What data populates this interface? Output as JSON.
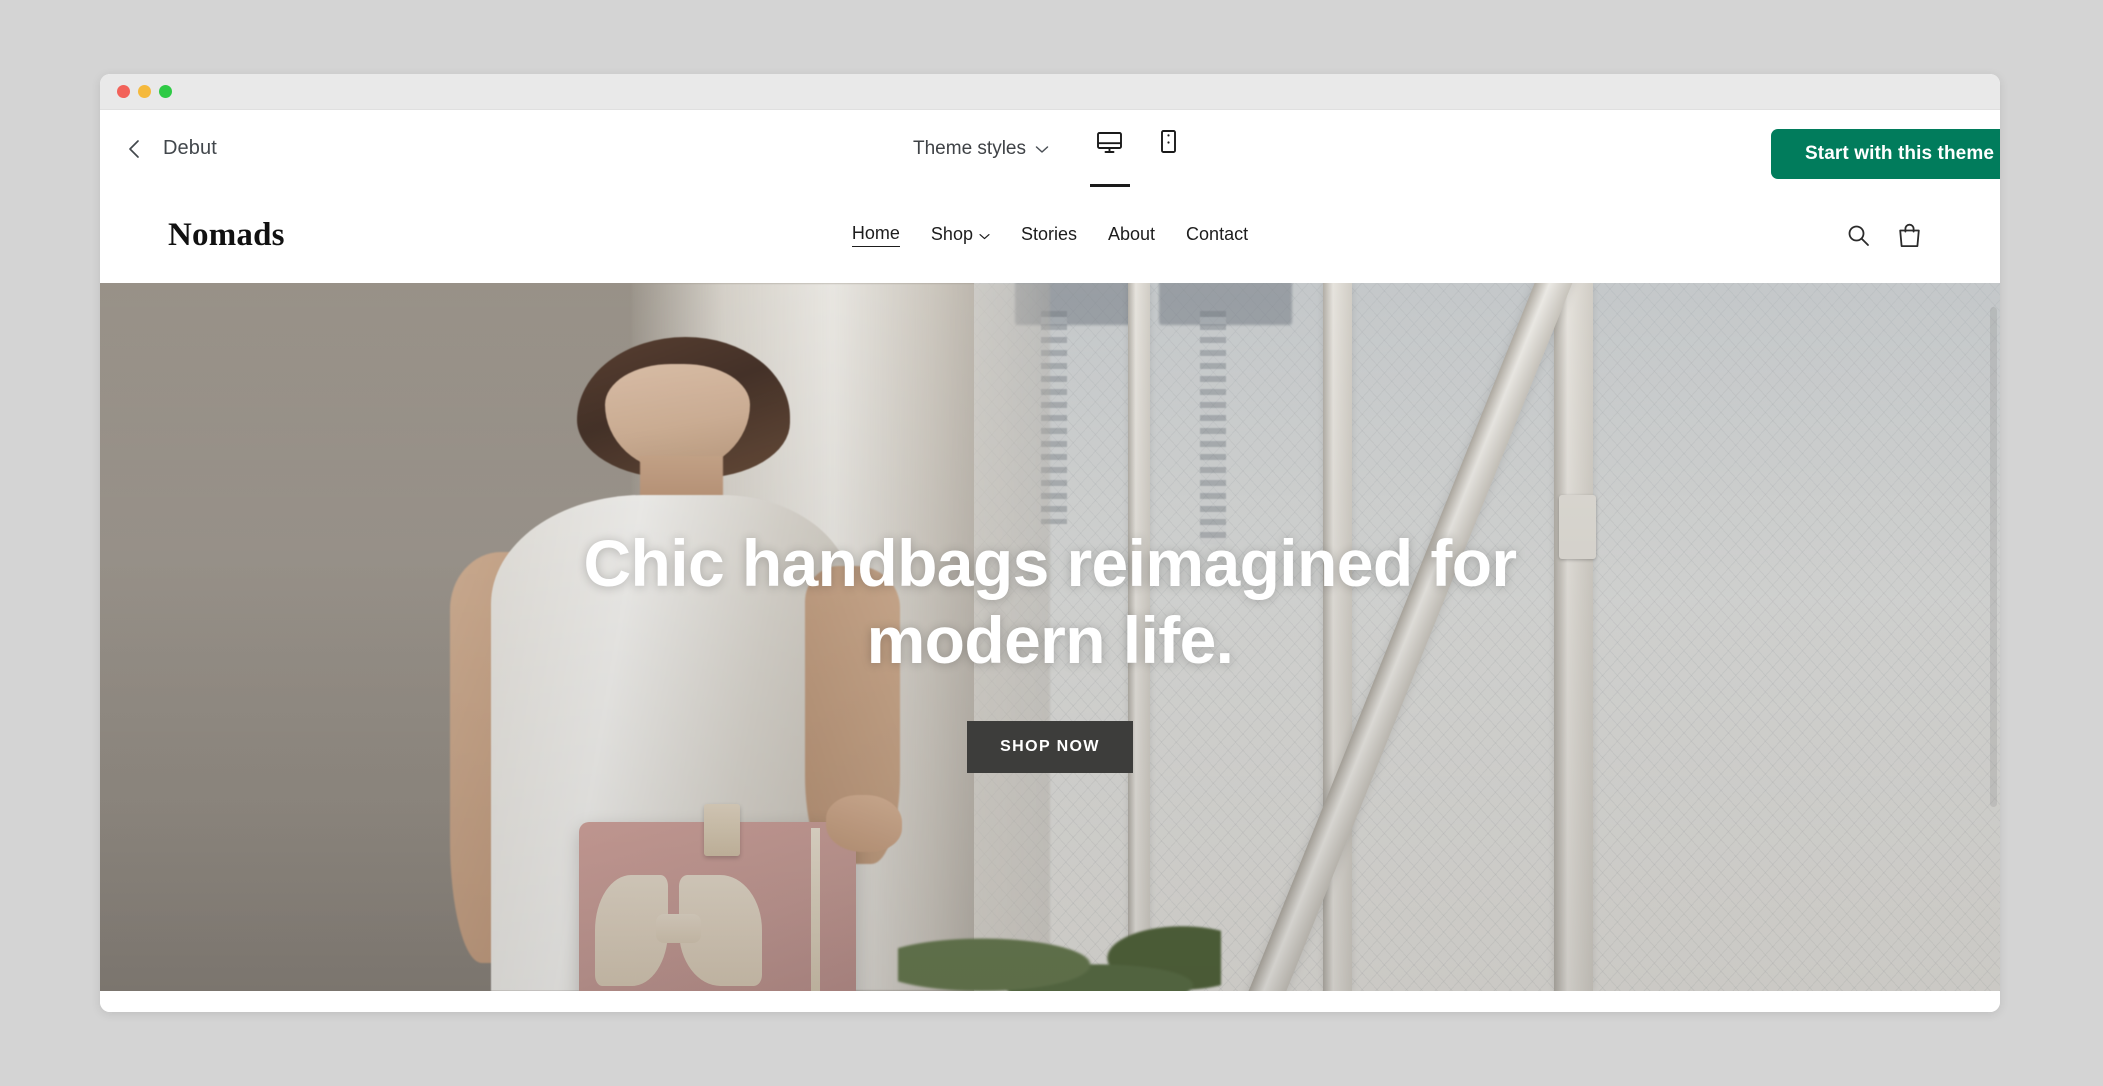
{
  "window": {
    "traffic_lights": [
      "close",
      "minimize",
      "zoom"
    ]
  },
  "toolbar": {
    "back_icon": "chevron-left-icon",
    "theme_name": "Debut",
    "theme_styles_label": "Theme styles",
    "theme_styles_chevron": "chevron-down-icon",
    "view_desktop_icon": "desktop-icon",
    "view_mobile_icon": "mobile-icon",
    "active_view": "desktop",
    "cta_label": "Start with this theme",
    "cta_color": "#017c5c"
  },
  "storefront": {
    "logo": "Nomads",
    "nav": [
      {
        "label": "Home",
        "active": true,
        "has_dropdown": false
      },
      {
        "label": "Shop",
        "active": false,
        "has_dropdown": true
      },
      {
        "label": "Stories",
        "active": false,
        "has_dropdown": false
      },
      {
        "label": "About",
        "active": false,
        "has_dropdown": false
      },
      {
        "label": "Contact",
        "active": false,
        "has_dropdown": false
      }
    ],
    "search_icon": "search-icon",
    "cart_icon": "shopping-bag-icon",
    "hero": {
      "title": "Chic handbags reimagined for modern life.",
      "button_label": "SHOP NOW",
      "button_color": "#3d3d3b",
      "image_description": "Woman in a white sleeveless top holding a dusty-pink handbag in front of tall white industrial windows"
    }
  }
}
